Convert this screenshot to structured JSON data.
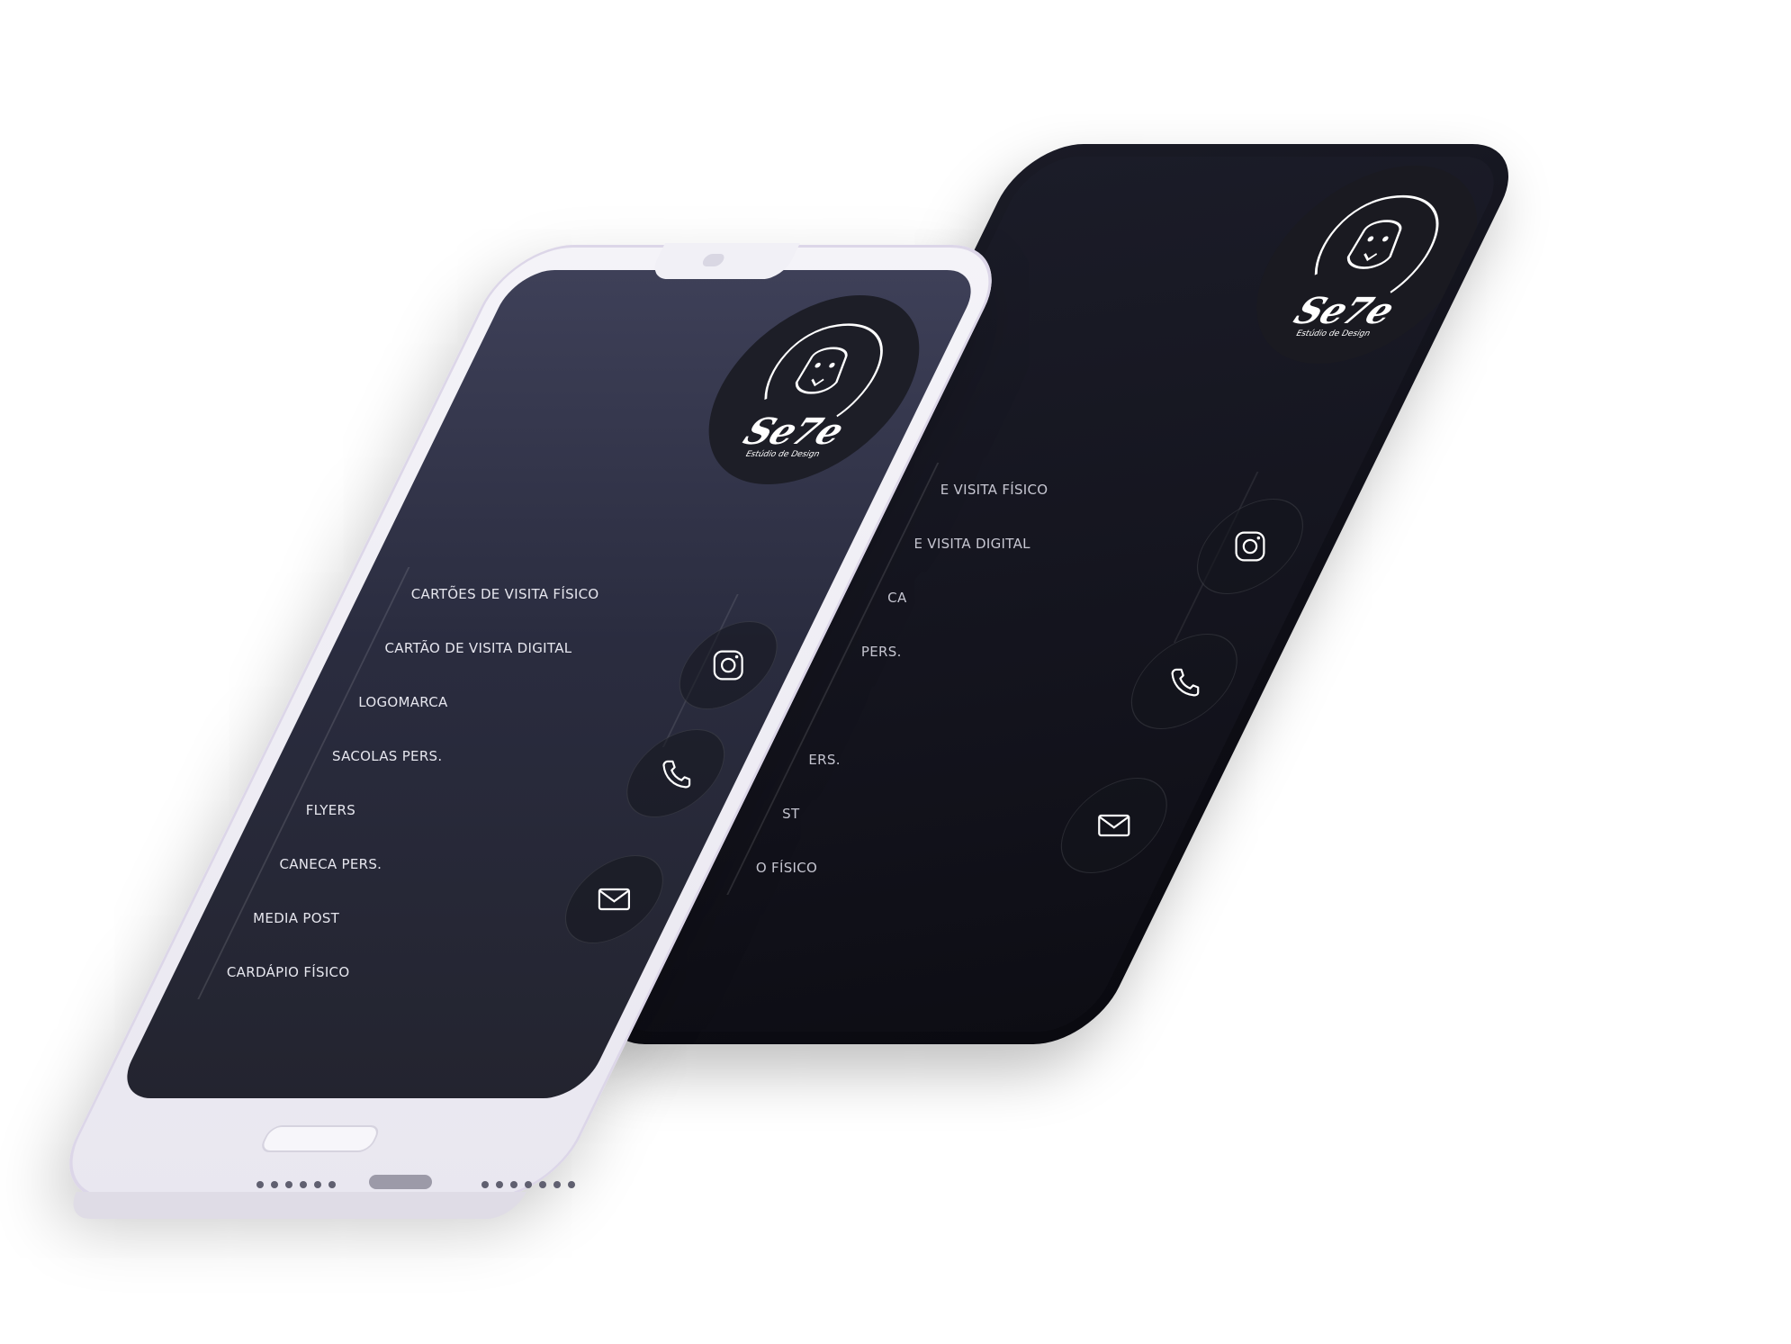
{
  "brand": {
    "name": "Se7e",
    "tagline": "Estúdio de Design"
  },
  "front_menu": [
    {
      "label": "CARTÕES DE VISITA FÍSICO"
    },
    {
      "label": "CARTÃO DE VISITA DIGITAL"
    },
    {
      "label": "LOGOMARCA"
    },
    {
      "label": "SACOLAS PERS."
    },
    {
      "label": "FLYERS"
    },
    {
      "label": "CANECA PERS."
    },
    {
      "label": "MEDIA POST"
    },
    {
      "label": "CARDÁPIO FÍSICO"
    }
  ],
  "back_menu": [
    {
      "label": "E VISITA FÍSICO"
    },
    {
      "label": "E VISITA DIGITAL"
    },
    {
      "label": "CA"
    },
    {
      "label": "PERS."
    },
    {
      "label": ""
    },
    {
      "label": "ERS."
    },
    {
      "label": "ST"
    },
    {
      "label": "O FÍSICO"
    }
  ],
  "icons": {
    "instagram": "instagram-icon",
    "phone": "phone-icon",
    "mail": "mail-icon"
  },
  "colors": {
    "screen_top": "#3e4058",
    "screen_bottom": "#23242f",
    "back_phone": "#0e0e16",
    "front_frame": "#f4f3f8",
    "text": "#e6e6ee"
  }
}
